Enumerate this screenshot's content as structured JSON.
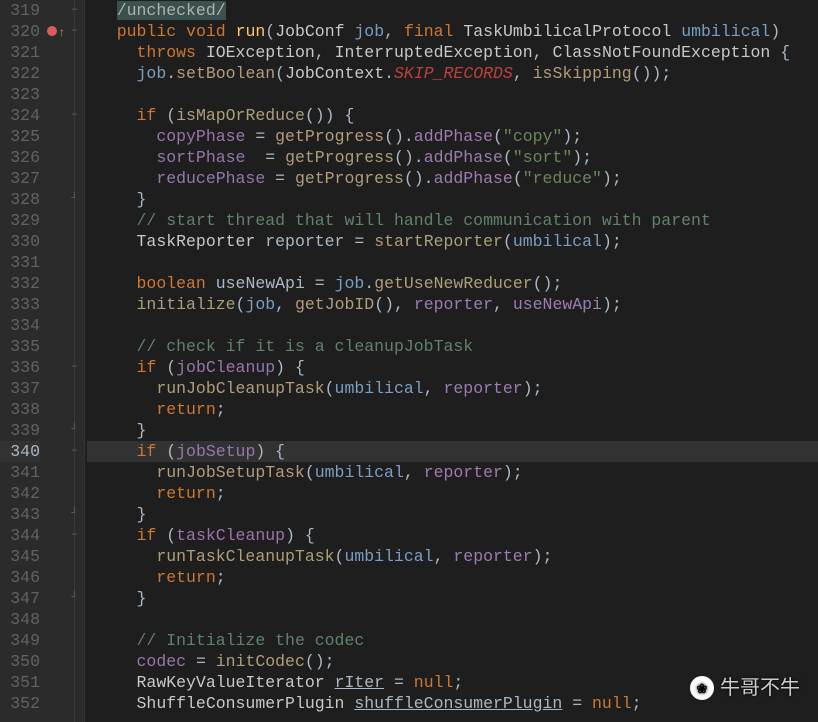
{
  "lines": {
    "start": 319,
    "end": 352,
    "current": 340
  },
  "annotation": "/unchecked/",
  "code": {
    "l320": {
      "public": "public",
      "void": "void",
      "run": "run",
      "JobConf": "JobConf",
      "job": "job",
      "final": "final",
      "TUP": "TaskUmbilicalProtocol",
      "umb": "umbilical"
    },
    "l321": {
      "throws": "throws",
      "IOE": "IOException",
      "IE": "InterruptedException",
      "CNF": "ClassNotFoundException"
    },
    "l322": {
      "job": "job",
      "setBoolean": "setBoolean",
      "JobContext": "JobContext",
      "SKIP": "SKIP_RECORDS",
      "isSkipping": "isSkipping"
    },
    "l324": {
      "if": "if",
      "isMapOrReduce": "isMapOrReduce"
    },
    "l325": {
      "copyPhase": "copyPhase",
      "getProgress": "getProgress",
      "addPhase": "addPhase",
      "s": "\"copy\""
    },
    "l326": {
      "sortPhase": "sortPhase",
      "getProgress": "getProgress",
      "addPhase": "addPhase",
      "s": "\"sort\""
    },
    "l327": {
      "reducePhase": "reducePhase",
      "getProgress": "getProgress",
      "addPhase": "addPhase",
      "s": "\"reduce\""
    },
    "l329": {
      "c": "// start thread that will handle communication with parent"
    },
    "l330": {
      "TaskReporter": "TaskReporter",
      "reporter": "reporter",
      "startReporter": "startReporter",
      "umb": "umbilical"
    },
    "l332": {
      "boolean": "boolean",
      "useNewApi": "useNewApi",
      "job": "job",
      "getUseNewReducer": "getUseNewReducer"
    },
    "l333": {
      "initialize": "initialize",
      "job": "job",
      "getJobID": "getJobID",
      "reporter": "reporter",
      "useNewApi": "useNewApi"
    },
    "l335": {
      "c": "// check if it is a cleanupJobTask"
    },
    "l336": {
      "if": "if",
      "jobCleanup": "jobCleanup"
    },
    "l337": {
      "runJobCleanupTask": "runJobCleanupTask",
      "umb": "umbilical",
      "reporter": "reporter"
    },
    "l338": {
      "return": "return"
    },
    "l340": {
      "if": "if",
      "jobSetup": "jobSetup"
    },
    "l341": {
      "runJobSetupTask": "runJobSetupTask",
      "umb": "umbilical",
      "reporter": "reporter"
    },
    "l342": {
      "return": "return"
    },
    "l344": {
      "if": "if",
      "taskCleanup": "taskCleanup"
    },
    "l345": {
      "runTaskCleanupTask": "runTaskCleanupTask",
      "umb": "umbilical",
      "reporter": "reporter"
    },
    "l346": {
      "return": "return"
    },
    "l349": {
      "c": "// Initialize the codec"
    },
    "l350": {
      "codec": "codec",
      "initCodec": "initCodec"
    },
    "l351": {
      "RKVI": "RawKeyValueIterator",
      "rIter": "rIter",
      "null": "null"
    },
    "l352": {
      "SCP": "ShuffleConsumerPlugin",
      "scp": "shuffleConsumerPlugin",
      "null": "null"
    }
  },
  "watermark": {
    "icon": "❀",
    "text": "牛哥不牛"
  }
}
